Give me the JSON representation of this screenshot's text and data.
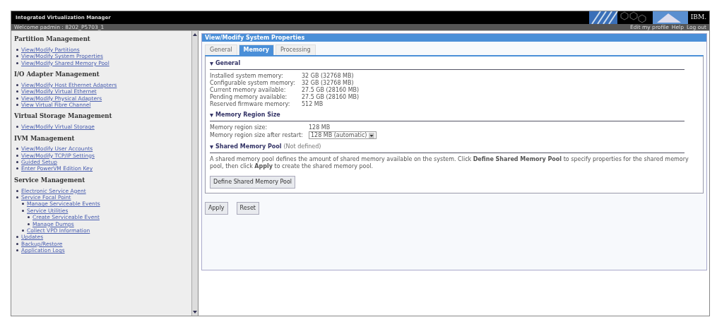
{
  "header": {
    "title": "Integrated Virtualization Manager",
    "welcome": "Welcome padmin : 8202_P5703_1",
    "logo": "IBM.",
    "links": [
      "Edit my profile",
      "Help",
      "Log out"
    ]
  },
  "sidebar": {
    "sections": [
      {
        "title": "Partition Management",
        "items": [
          {
            "label": "View/Modify Partitions"
          },
          {
            "label": "View/Modify System Properties"
          },
          {
            "label": "View/Modify Shared Memory Pool"
          }
        ]
      },
      {
        "title": "I/O Adapter Management",
        "items": [
          {
            "label": "View/Modify Host Ethernet Adapters"
          },
          {
            "label": "View/Modify Virtual Ethernet"
          },
          {
            "label": "View/Modify Physical Adapters"
          },
          {
            "label": "View Virtual Fibre Channel"
          }
        ]
      },
      {
        "title": "Virtual Storage Management",
        "items": [
          {
            "label": "View/Modify Virtual Storage"
          }
        ]
      },
      {
        "title": "IVM Management",
        "items": [
          {
            "label": "View/Modify User Accounts"
          },
          {
            "label": "View/Modify TCP/IP Settings"
          },
          {
            "label": "Guided Setup"
          },
          {
            "label": "Enter PowerVM Edition Key"
          }
        ]
      },
      {
        "title": "Service Management",
        "items": [
          {
            "label": "Electronic Service Agent"
          },
          {
            "label": "Service Focal Point",
            "children": [
              {
                "label": "Manage Serviceable Events"
              },
              {
                "label": "Service Utilities",
                "children": [
                  {
                    "label": "Create Serviceable Event"
                  },
                  {
                    "label": "Manage Dumps"
                  }
                ]
              },
              {
                "label": "Collect VPD Information"
              }
            ]
          },
          {
            "label": "Updates"
          },
          {
            "label": "Backup/Restore"
          },
          {
            "label": "Application Logs"
          }
        ]
      }
    ]
  },
  "panel": {
    "title": "View/Modify System Properties",
    "tabs": [
      {
        "label": "General",
        "selected": false
      },
      {
        "label": "Memory",
        "selected": true
      },
      {
        "label": "Processing",
        "selected": false
      }
    ],
    "general": {
      "title": "General",
      "rows": [
        {
          "label": "Installed system memory:",
          "value": "32 GB (32768 MB)"
        },
        {
          "label": "Configurable system memory:",
          "value": "32 GB (32768 MB)"
        },
        {
          "label": "Current memory available:",
          "value": "27.5 GB (28160 MB)"
        },
        {
          "label": "Pending memory available:",
          "value": "27.5 GB (28160 MB)"
        },
        {
          "label": "Reserved firmware memory:",
          "value": "512 MB"
        }
      ]
    },
    "region": {
      "title": "Memory Region Size",
      "size_label": "Memory region size:",
      "size_value": "128 MB",
      "restart_label": "Memory region size after restart:",
      "restart_value": "128 MB (automatic)"
    },
    "pool": {
      "title": "Shared Memory Pool",
      "status": "(Not defined)",
      "description": "A shared memory pool defines the amount of shared memory available on the system. Click **Define Shared Memory Pool** to specify properties for the shared memory pool, then click **Apply** to create the shared memory pool.",
      "button": "Define Shared Memory Pool"
    },
    "buttons": [
      "Apply",
      "Reset"
    ]
  }
}
